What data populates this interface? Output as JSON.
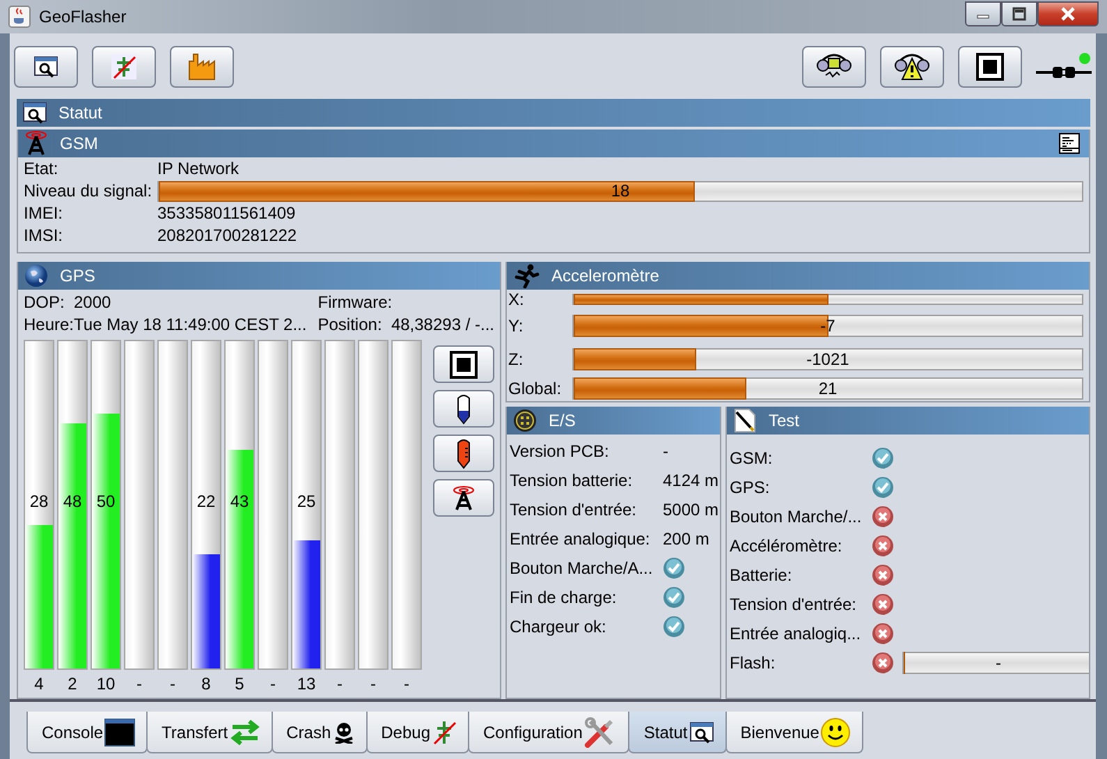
{
  "window": {
    "title": "GeoFlasher"
  },
  "statut": {
    "title": "Statut"
  },
  "gsm": {
    "title": "GSM",
    "fields": [
      {
        "kind": "text",
        "label": "Etat:",
        "value": "IP Network"
      },
      {
        "kind": "bar",
        "label": "Niveau du signal:",
        "level": 0.58,
        "reading": "18"
      },
      {
        "kind": "text",
        "label": "IMEI:",
        "value": "353358011561409"
      },
      {
        "kind": "text",
        "label": "IMSI:",
        "value": "208201700281222"
      }
    ]
  },
  "gps": {
    "title": "GPS",
    "dop_label": "DOP:",
    "dop": "2000",
    "firmware_label": "Firmware:",
    "time_label": "Heure:",
    "time": "Tue May 18 11:49:00 CEST 2...",
    "position_label": "Position:",
    "position": "48,38293 / -...",
    "satellites": [
      {
        "reading": "28",
        "level": 0.44,
        "color": "#22ee22",
        "number": "4"
      },
      {
        "reading": "48",
        "level": 0.75,
        "color": "#22ee22",
        "number": "2"
      },
      {
        "reading": "50",
        "level": 0.78,
        "color": "#22ee22",
        "number": "10"
      },
      {
        "level": 0,
        "number": "-"
      },
      {
        "level": 0,
        "number": "-"
      },
      {
        "reading": "22",
        "level": 0.35,
        "color": "#2222ee",
        "number": "8"
      },
      {
        "reading": "43",
        "level": 0.67,
        "color": "#22ee22",
        "number": "5"
      },
      {
        "level": 0,
        "number": "-"
      },
      {
        "reading": "25",
        "level": 0.39,
        "color": "#2222ee",
        "number": "13"
      },
      {
        "level": 0,
        "number": "-"
      },
      {
        "level": 0,
        "number": "-"
      },
      {
        "level": 0,
        "number": "-"
      }
    ]
  },
  "accelerometer": {
    "title": "Acceleromètre",
    "rows": [
      {
        "label": "X:",
        "level": 0.5
      },
      {
        "label": "Y:",
        "level": 0.5,
        "reading": "-7"
      },
      {
        "label": "Z:",
        "level": 0.24,
        "reading": "-1021"
      },
      {
        "label": "Global:",
        "level": 0.34,
        "reading": "21"
      }
    ]
  },
  "es": {
    "title": "E/S",
    "rows": [
      {
        "kind": "text",
        "label": "Version PCB:",
        "value": "-"
      },
      {
        "kind": "text",
        "label": "Tension batterie:",
        "value": "4124 m"
      },
      {
        "kind": "text",
        "label": "Tension d'entrée:",
        "value": "5000 m"
      },
      {
        "kind": "text",
        "label": "Entrée analogique:",
        "value": "200 m"
      },
      {
        "kind": "check",
        "label": "Bouton Marche/A...",
        "ok": true
      },
      {
        "kind": "check",
        "label": "Fin de charge:",
        "ok": true
      },
      {
        "kind": "check",
        "label": "Chargeur ok:",
        "ok": true
      }
    ]
  },
  "test": {
    "title": "Test",
    "rows": [
      {
        "label": "GSM:",
        "ok": true
      },
      {
        "label": "GPS:",
        "ok": true
      },
      {
        "label": "Bouton Marche/...",
        "ok": false
      },
      {
        "label": "Accéléromètre:",
        "ok": false
      },
      {
        "label": "Batterie:",
        "ok": false
      },
      {
        "label": "Tension d'entrée:",
        "ok": false
      },
      {
        "label": "Entrée analogiq...",
        "ok": false
      },
      {
        "label": "Flash:",
        "ok": false,
        "bar": {
          "level": 0,
          "reading": "-"
        }
      }
    ]
  },
  "tabs": [
    {
      "kind": "console",
      "label": "Console",
      "selected": false
    },
    {
      "kind": "transfer",
      "label": "Transfert",
      "selected": false
    },
    {
      "kind": "crash",
      "label": "Crash",
      "selected": false
    },
    {
      "kind": "debug",
      "label": "Debug",
      "selected": false
    },
    {
      "kind": "configuration",
      "label": "Configuration",
      "selected": false
    },
    {
      "kind": "statut",
      "label": "Statut",
      "selected": true
    },
    {
      "kind": "welcome",
      "label": "Bienvenue",
      "selected": false
    }
  ]
}
